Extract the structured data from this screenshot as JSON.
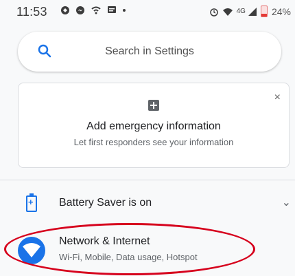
{
  "status_bar": {
    "time": "11:53",
    "network": "4G",
    "battery_percent": "24%"
  },
  "search": {
    "placeholder": "Search in Settings"
  },
  "emergency_card": {
    "title": "Add emergency information",
    "subtitle": "Let first responders see your information",
    "close_symbol": "×"
  },
  "battery_row": {
    "label": "Battery Saver is on",
    "chevron": "⌄"
  },
  "network_row": {
    "title": "Network & Internet",
    "subtitle": "Wi-Fi, Mobile, Data usage, Hotspot"
  },
  "colors": {
    "accent": "#1a73e8",
    "highlight": "#d6001c"
  },
  "icons": [
    "search-icon",
    "close-icon",
    "plus-icon",
    "battery-saver-icon",
    "chevron-down-icon",
    "wifi-icon"
  ]
}
